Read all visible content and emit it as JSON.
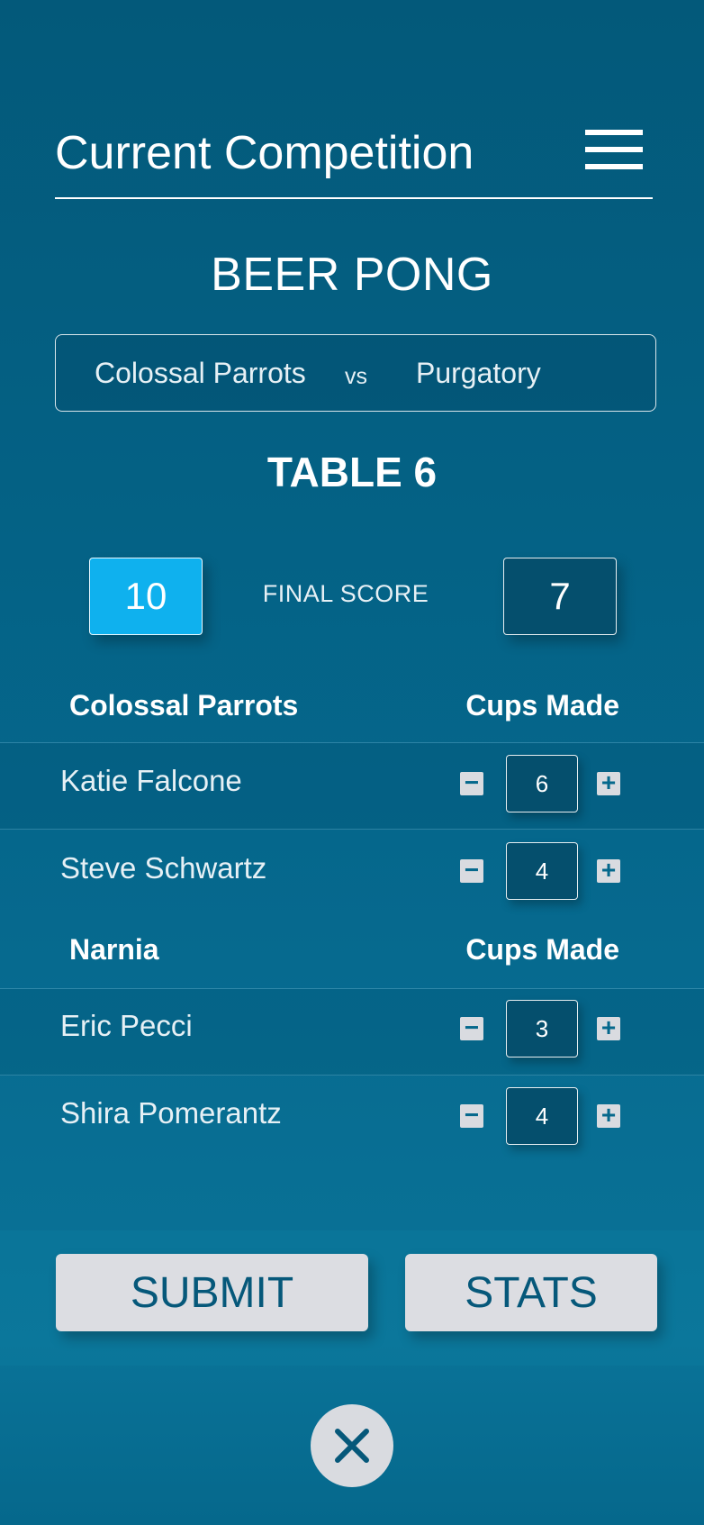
{
  "header": {
    "title": "Current Competition"
  },
  "game": {
    "name": "BEER PONG"
  },
  "matchup": {
    "team_a": "Colossal Parrots",
    "vs": "vs",
    "team_b": "Purgatory"
  },
  "table": {
    "label": "TABLE 6"
  },
  "score": {
    "left": "10",
    "label": "FINAL SCORE",
    "right": "7",
    "left_color": "#0fb1ee"
  },
  "teams": [
    {
      "name": "Colossal Parrots",
      "column_label": "Cups Made",
      "players": [
        {
          "name": "Katie Falcone",
          "cups": "6"
        },
        {
          "name": "Steve Schwartz",
          "cups": "4"
        }
      ]
    },
    {
      "name": "Narnia",
      "column_label": "Cups Made",
      "players": [
        {
          "name": "Eric Pecci",
          "cups": "3"
        },
        {
          "name": "Shira Pomerantz",
          "cups": "4"
        }
      ]
    }
  ],
  "actions": {
    "submit": "SUBMIT",
    "stats": "STATS"
  },
  "stepper": {
    "minus": "−",
    "plus": "+"
  },
  "icons": {
    "menu": "hamburger-menu-icon",
    "close": "close-icon"
  }
}
